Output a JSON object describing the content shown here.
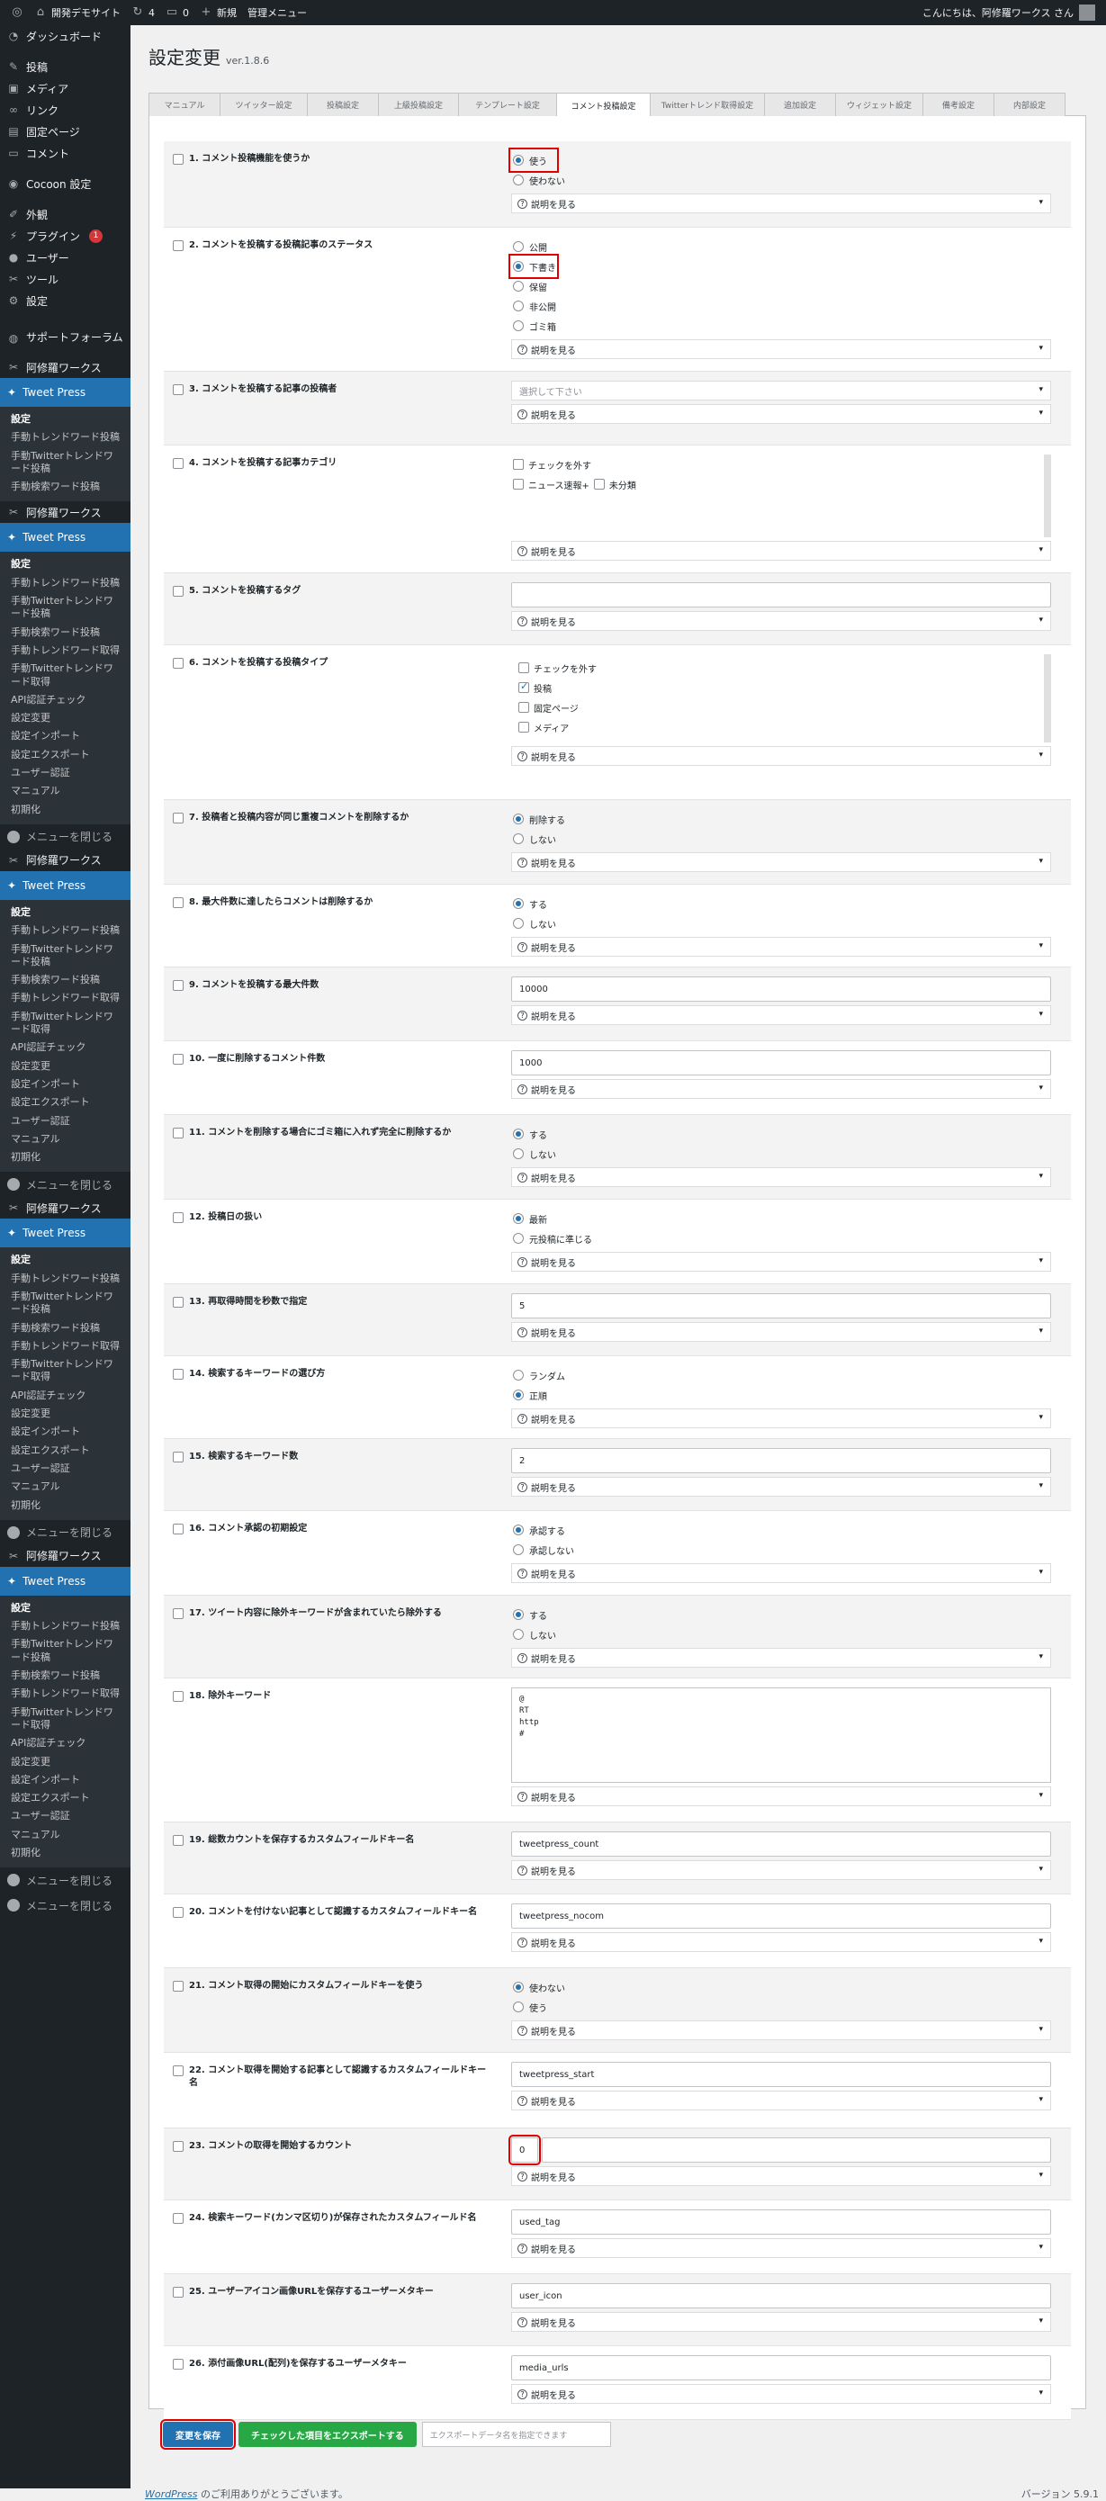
{
  "adminbar": {
    "site": "開発デモサイト",
    "updates": "4",
    "comments": "0",
    "new": "新規",
    "admin_menu": "管理メニュー",
    "greeting": "こんにちは、阿修羅ワークス さん"
  },
  "sidebar": {
    "main_items": [
      {
        "label": "ダッシュボード",
        "icon": "dashboard-icon"
      },
      {
        "label": "投稿",
        "icon": "pin-icon"
      },
      {
        "label": "メディア",
        "icon": "media-icon"
      },
      {
        "label": "リンク",
        "icon": "link-icon"
      },
      {
        "label": "固定ページ",
        "icon": "page-icon"
      },
      {
        "label": "コメント",
        "icon": "comment-icon"
      },
      {
        "label": "Cocoon 設定",
        "icon": "cocoon-icon"
      },
      {
        "label": "外観",
        "icon": "appearance-icon"
      },
      {
        "label": "プラグイン",
        "icon": "plugin-icon",
        "badge": "1"
      },
      {
        "label": "ユーザー",
        "icon": "user-icon"
      },
      {
        "label": "ツール",
        "icon": "tool-icon"
      },
      {
        "label": "設定",
        "icon": "settings-icon"
      },
      {
        "label": "サポートフォーラム",
        "icon": "support-icon"
      }
    ],
    "asura_label": "阿修羅ワークス",
    "tweetpress_label": "Tweet Press",
    "first_sub": [
      "設定",
      "手動トレンドワード投稿",
      "手動Twitterトレンドワード投稿",
      "手動検索ワード投稿"
    ],
    "full_sub": [
      "設定",
      "手動トレンドワード投稿",
      "手動Twitterトレンドワード投稿",
      "手動検索ワード投稿",
      "手動トレンドワード取得",
      "手動Twitterトレンドワード取得",
      "API認証チェック",
      "設定変更",
      "設定インポート",
      "設定エクスポート",
      "ユーザー認証",
      "マニュアル",
      "初期化"
    ],
    "collapse_label": "メニューを閉じる"
  },
  "page": {
    "title": "設定変更",
    "version": "ver.1.8.6"
  },
  "tabs": [
    "マニュアル",
    "ツイッター設定",
    "投稿設定",
    "上級投稿設定",
    "テンプレート設定",
    "コメント投稿設定",
    "Twitterトレンド取得設定",
    "追加設定",
    "ウィジェット設定",
    "備考設定",
    "内部設定"
  ],
  "explain_label": "説明を見る",
  "settings": [
    {
      "label": "1. コメント投稿機能を使うか",
      "type": "radio",
      "options": [
        "使う",
        "使わない"
      ],
      "selected": 0,
      "highlight": true
    },
    {
      "label": "2. コメントを投稿する投稿記事のステータス",
      "type": "radio",
      "options": [
        "公開",
        "下書き",
        "保留",
        "非公開",
        "ゴミ箱"
      ],
      "selected": 1,
      "highlight": true
    },
    {
      "label": "3. コメントを投稿する記事の投稿者",
      "type": "select",
      "value": "選択して下さい"
    },
    {
      "label": "4. コメントを投稿する記事カテゴリ",
      "type": "category",
      "uncheck": "チェックを外す",
      "cat1": "ニュース速報+",
      "cat2": "未分類"
    },
    {
      "label": "5. コメントを投稿するタグ",
      "type": "text",
      "value": ""
    },
    {
      "label": "6. コメントを投稿する投稿タイプ",
      "type": "checklist",
      "options": [
        "チェックを外す",
        "投稿",
        "固定ページ",
        "メディア"
      ],
      "checked": [
        false,
        true,
        false,
        false
      ]
    },
    {
      "label": "7. 投稿者と投稿内容が同じ重複コメントを削除するか",
      "type": "radio",
      "options": [
        "削除する",
        "しない"
      ],
      "selected": 0
    },
    {
      "label": "8. 最大件数に達したらコメントは削除するか",
      "type": "radio",
      "options": [
        "する",
        "しない"
      ],
      "selected": 0
    },
    {
      "label": "9. コメントを投稿する最大件数",
      "type": "text",
      "value": "10000"
    },
    {
      "label": "10. 一度に削除するコメント件数",
      "type": "text",
      "value": "1000"
    },
    {
      "label": "11. コメントを削除する場合にゴミ箱に入れず完全に削除するか",
      "type": "radio",
      "options": [
        "する",
        "しない"
      ],
      "selected": 0
    },
    {
      "label": "12. 投稿日の扱い",
      "type": "radio",
      "options": [
        "最新",
        "元投稿に準じる"
      ],
      "selected": 0
    },
    {
      "label": "13. 再取得時間を秒数で指定",
      "type": "text",
      "value": "5"
    },
    {
      "label": "14. 検索するキーワードの選び方",
      "type": "radio",
      "options": [
        "ランダム",
        "正順"
      ],
      "selected": 1
    },
    {
      "label": "15. 検索するキーワード数",
      "type": "text",
      "value": "2"
    },
    {
      "label": "16. コメント承認の初期設定",
      "type": "radio",
      "options": [
        "承認する",
        "承認しない"
      ],
      "selected": 0
    },
    {
      "label": "17. ツイート内容に除外キーワードが含まれていたら除外する",
      "type": "radio",
      "options": [
        "する",
        "しない"
      ],
      "selected": 0
    },
    {
      "label": "18. 除外キーワード",
      "type": "textarea",
      "value": "@\nRT\nhttp\n#"
    },
    {
      "label": "19. 総数カウントを保存するカスタムフィールドキー名",
      "type": "text",
      "value": "tweetpress_count"
    },
    {
      "label": "20. コメントを付けない記事として認識するカスタムフィールドキー名",
      "type": "text",
      "value": "tweetpress_nocom"
    },
    {
      "label": "21. コメント取得の開始にカスタムフィールドキーを使う",
      "type": "radio",
      "options": [
        "使わない",
        "使う"
      ],
      "selected": 0
    },
    {
      "label": "22. コメント取得を開始する記事として認識するカスタムフィールドキー名",
      "type": "text",
      "value": "tweetpress_start"
    },
    {
      "label": "23. コメントの取得を開始するカウント",
      "type": "text",
      "value": "0",
      "highlight": true
    },
    {
      "label": "24. 検索キーワード(カンマ区切り)が保存されたカスタムフィールド名",
      "type": "text",
      "value": "used_tag"
    },
    {
      "label": "25. ユーザーアイコン画像URLを保存するユーザーメタキー",
      "type": "text",
      "value": "user_icon"
    },
    {
      "label": "26. 添付画像URL(配列)を保存するユーザーメタキー",
      "type": "text",
      "value": "media_urls"
    }
  ],
  "buttons": {
    "save": "変更を保存",
    "export": "チェックした項目をエクスポートする",
    "export_placeholder": "エクスポートデータ名を指定できます"
  },
  "footer": {
    "wp_link": "WordPress",
    "thanks": " のご利用ありがとうございます。",
    "version": "バージョン 5.9.1"
  }
}
